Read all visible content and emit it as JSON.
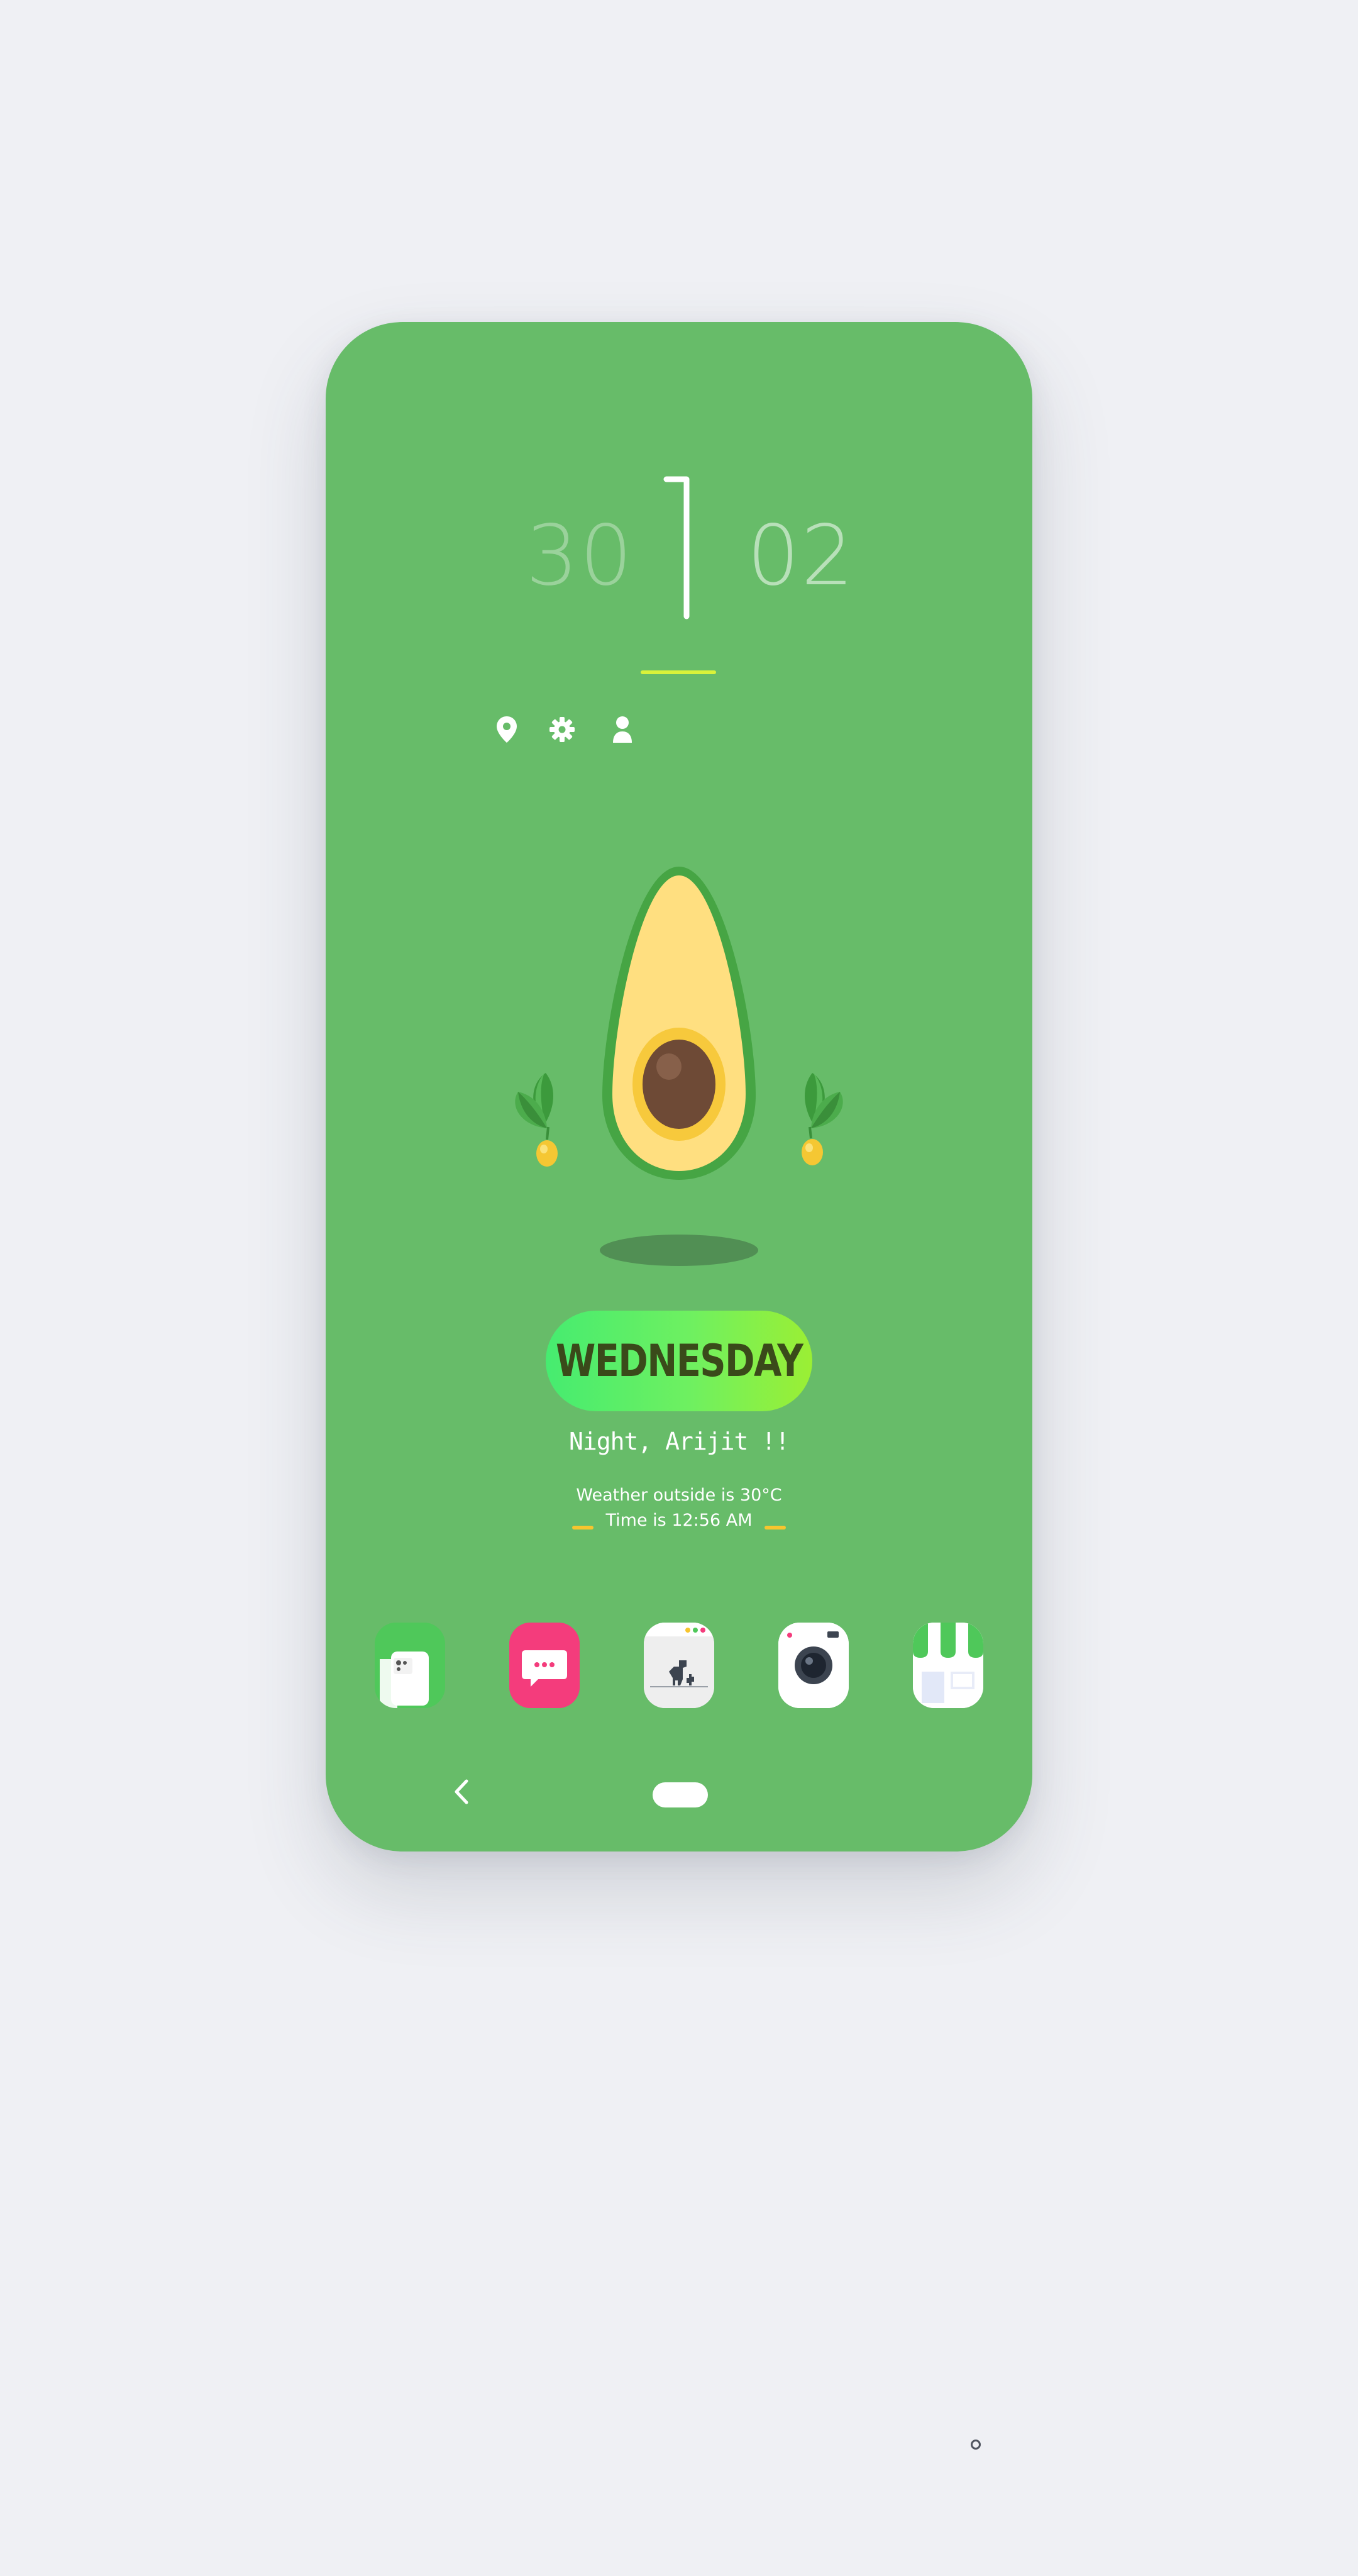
{
  "clock": {
    "minutes": "30",
    "day_number": "02",
    "hour_glyph": "1"
  },
  "quick_icons": [
    "location-pin-icon",
    "gear-icon",
    "user-icon"
  ],
  "day_label": "WEDNESDAY",
  "greeting": "Night, Arijit !!",
  "info": {
    "weather": "Weather outside is 30°C",
    "time": "Time is 12:56 AM"
  },
  "dock_apps": [
    "phone-app-icon",
    "messages-app-icon",
    "browser-app-icon",
    "camera-app-icon",
    "store-app-icon"
  ],
  "colors": {
    "background": "#67bc69",
    "accent_line": "#d9f23a",
    "accent_dash": "#f7c52e",
    "pill_start": "#46ec70",
    "pill_end": "#9bef34",
    "messages_app": "#f43c7c"
  }
}
